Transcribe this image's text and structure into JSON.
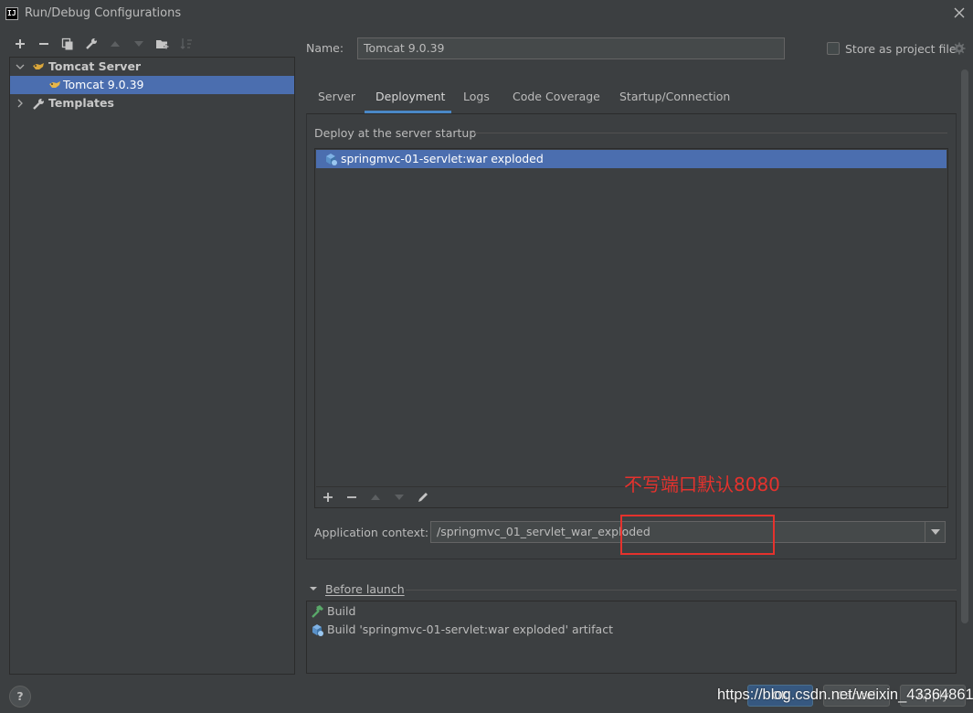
{
  "window": {
    "title": "Run/Debug Configurations",
    "app_icon": "IJ"
  },
  "toolbar": {
    "icons": [
      "plus-icon",
      "minus-icon",
      "copy-icon",
      "wrench-icon",
      "arrow-up-icon",
      "arrow-down-icon",
      "folder-add-icon",
      "sort-icon"
    ]
  },
  "tree": {
    "group": "Tomcat Server",
    "child": "Tomcat 9.0.39",
    "templates": "Templates"
  },
  "form": {
    "name_label": "Name:",
    "name_value": "Tomcat 9.0.39",
    "store_label": "Store as project file"
  },
  "tabs": [
    {
      "label": "Server"
    },
    {
      "label": "Deployment",
      "active": true
    },
    {
      "label": "Logs"
    },
    {
      "label": "Code Coverage"
    },
    {
      "label": "Startup/Connection"
    }
  ],
  "deployment": {
    "section_title": "Deploy at the server startup",
    "items": [
      "springmvc-01-servlet:war exploded"
    ],
    "context_label": "Application context:",
    "context_value": "/springmvc_01_servlet_war_exploded"
  },
  "annotation": {
    "text": "不写端口默认8080",
    "color": "#e5322d"
  },
  "before_launch": {
    "title": "Before launch",
    "items": [
      "Build",
      "Build 'springmvc-01-servlet:war exploded' artifact"
    ]
  },
  "buttons": {
    "help": "?",
    "ok": "OK",
    "cancel": "Cancel",
    "apply": "Apply"
  },
  "watermark": "https://blog.csdn.net/weixin_43364861",
  "colors": {
    "selection": "#4b6eaf",
    "accent": "#4a88c7",
    "background": "#3c3f41"
  }
}
